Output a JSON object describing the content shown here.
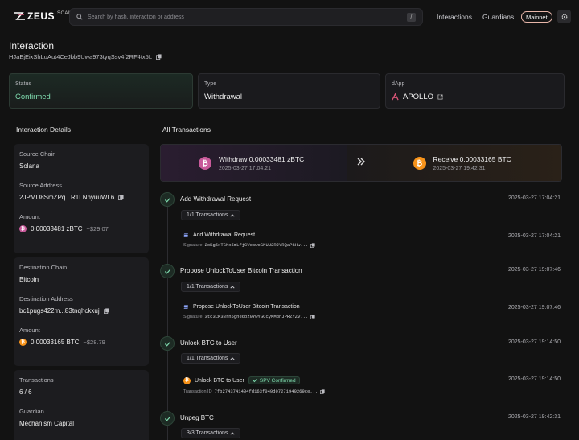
{
  "header": {
    "logo_text": "ZEUS",
    "logo_sub": "SCAN",
    "search_placeholder": "Search by hash, interaction or address",
    "search_kbd": "/",
    "nav": [
      "Interactions",
      "Guardians"
    ],
    "network": "Mainnet",
    "icons": [
      "zeus-logo-icon",
      "search-icon",
      "gear-icon"
    ]
  },
  "page": {
    "title": "Interaction",
    "hash": "HJaEjEixShLuAut4CeJbb9Uwa973tyqSsv4f2RF4tx5L"
  },
  "cards": {
    "status": {
      "label": "Status",
      "value": "Confirmed"
    },
    "type": {
      "label": "Type",
      "value": "Withdrawal"
    },
    "dapp": {
      "label": "dApp",
      "value": "APOLLO"
    }
  },
  "details": {
    "title": "Interaction Details",
    "source_chain_label": "Source Chain",
    "source_chain": "Solana",
    "source_address_label": "Source Address",
    "source_address": "2JPMU8SmZPq...R1LNhyuuWL6",
    "amount_label": "Amount",
    "source_amount": "0.00033481 zBTC",
    "source_usd": "~$29.07",
    "dest_chain_label": "Destination Chain",
    "dest_chain": "Bitcoin",
    "dest_address_label": "Destination Address",
    "dest_address": "bc1pugs422m...83tnqhckxuj",
    "dest_amount_label": "Amount",
    "dest_amount": "0.00033165 BTC",
    "dest_usd": "~$28.79",
    "transactions_label": "Transactions",
    "transactions": "6 / 6",
    "guardian_label": "Guardian",
    "guardian": "Mechanism Capital"
  },
  "all_tx": {
    "title": "All Transactions",
    "withdraw": "Withdraw 0.00033481 zBTC",
    "withdraw_date": "2025-03-27 17:04:21",
    "receive": "Receive 0.00033165 BTC",
    "receive_date": "2025-03-27 19:42:31",
    "steps": [
      {
        "title": "Add Withdrawal Request",
        "date": "2025-03-27 17:04:21",
        "pill": "1/1 Transactions",
        "sub_title": "Add Withdrawal Request",
        "sub_date": "2025-03-27 17:04:21",
        "meta_label": "Signature",
        "meta_value": "2oKg5xTGNx5mLfjCVesweGNUU2RJYRQaPSHw..."
      },
      {
        "title": "Propose UnlockToUser Bitcoin Transaction",
        "date": "2025-03-27 19:07:46",
        "pill": "1/1 Transactions",
        "sub_title": "Propose UnlockToUser Bitcoin Transaction",
        "sub_date": "2025-03-27 19:07:46",
        "meta_label": "Signature",
        "meta_value": "3tc3CK38rn5ghe6bz9YwYGCcyMMdnJPRZYZv..."
      },
      {
        "title": "Unlock BTC to User",
        "date": "2025-03-27 19:14:50",
        "pill": "1/1 Transactions",
        "sub_title": "Unlock BTC to User",
        "sub_badge": "SPV Confirmed",
        "sub_date": "2025-03-27 19:14:50",
        "meta_label": "Transaction ID",
        "meta_value": "7fb2743741404fd163f049d07271949269ce..."
      },
      {
        "title": "Unpeg BTC",
        "date": "2025-03-27 19:42:31",
        "pill": "3/3 Transactions"
      }
    ]
  },
  "colors": {
    "background": "#121212",
    "confirmed_green": "#7ed9ad",
    "btc_orange": "#f7931a",
    "zbtc_pink": "#c85a9a",
    "network_border": "#e8b6a9"
  }
}
